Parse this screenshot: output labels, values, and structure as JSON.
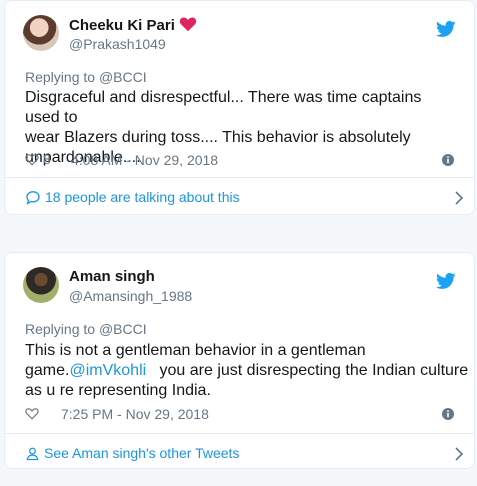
{
  "tweets": [
    {
      "name": "Cheeku Ki Pari",
      "handle": "@Prakash1049",
      "reply_prefix": "Replying to ",
      "reply_to": "@BCCI",
      "body_lines": [
        "Disgraceful and disrespectful... There was time captains used to",
        "wear Blazers during toss.... This behavior is absolutely",
        "unpardonable...."
      ],
      "likes": "8",
      "timestamp": "4:08 AM - Nov 29, 2018",
      "footer": "18 people are talking about this"
    },
    {
      "name": "Aman singh",
      "handle": "@Amansingh_1988",
      "reply_prefix": "Replying to ",
      "reply_to": "@BCCI",
      "body_line1": "This is not a gentleman behavior in a gentleman",
      "body_line2_prefix": "game.",
      "body_mention": "@imVkohli",
      "body_line2_suffix": "   you are just disrespecting the Indian culture",
      "body_line3": "as u re representing India.",
      "timestamp": "7:25 PM - Nov 29, 2018",
      "footer": "See Aman singh's other Tweets"
    }
  ],
  "colors": {
    "twitter_blue": "#1da1f2",
    "link_blue": "#1b95e0",
    "heart_red": "#e0245e",
    "muted": "#657786"
  }
}
